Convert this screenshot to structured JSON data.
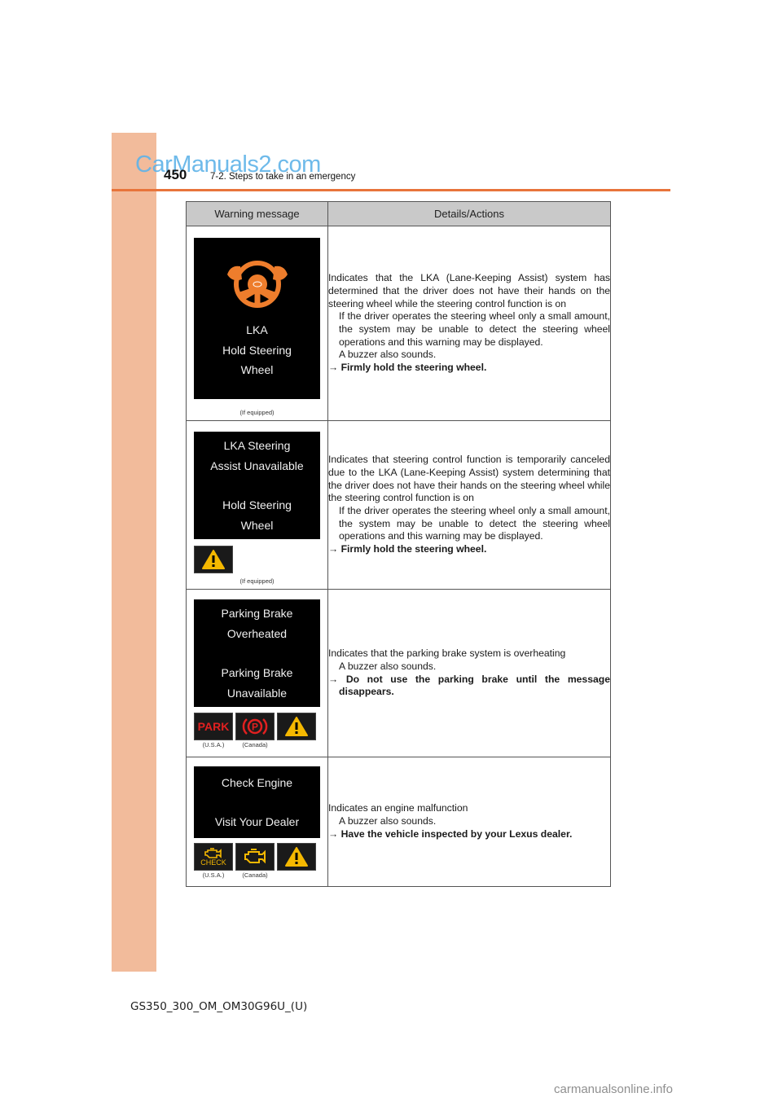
{
  "header": {
    "page_number": "450",
    "section_title": "7-2. Steps to take in an emergency",
    "watermark": "CarManuals2.com"
  },
  "table": {
    "columns": [
      "Warning message",
      "Details/Actions"
    ],
    "rows": [
      {
        "screen_lines": [
          "LKA",
          "Hold Steering",
          "Wheel"
        ],
        "screen_icon": "steering-wheel-hands-icon",
        "note": "(If equipped)",
        "indicators": [],
        "details": {
          "main": "Indicates that the LKA (Lane-Keeping Assist) system has determined that the driver does not have their hands on the steering wheel while the steering control function is on",
          "sub": [
            "If the driver operates the steering wheel only a small amount, the system may be unable to detect the steering wheel operations and this warning may be displayed.",
            "A buzzer also sounds."
          ],
          "action": "Firmly hold the steering wheel."
        }
      },
      {
        "screen_lines": [
          "LKA Steering",
          "Assist Unavailable",
          "",
          "Hold Steering",
          "Wheel"
        ],
        "note": "(If equipped)",
        "indicators": [
          {
            "icon": "master-warning-icon",
            "label": ""
          }
        ],
        "details": {
          "main": "Indicates that steering control function is temporarily canceled due to the LKA (Lane-Keeping Assist) system determining that the driver does not have their hands on the steering wheel while the steering control function is on",
          "sub": [
            "If the driver operates the steering wheel only a small amount, the system may be unable to detect the steering wheel operations and this warning may be displayed."
          ],
          "action": "Firmly hold the steering wheel."
        }
      },
      {
        "screen_lines": [
          "Parking Brake",
          "Overheated",
          "",
          "Parking Brake",
          "Unavailable"
        ],
        "note": "",
        "indicators": [
          {
            "icon": "park-text-icon",
            "text": "PARK",
            "label": "(U.S.A.)",
            "color": "#e02020"
          },
          {
            "icon": "parking-brake-p-icon",
            "text": "P",
            "label": "(Canada)",
            "color": "#e02020"
          },
          {
            "icon": "master-warning-icon",
            "label": ""
          }
        ],
        "details": {
          "main": "Indicates that the parking brake system is overheating",
          "sub": [
            "A buzzer also sounds."
          ],
          "action": "Do not use the parking brake until the message disappears."
        }
      },
      {
        "screen_lines": [
          "Check Engine",
          "",
          "Visit Your Dealer"
        ],
        "note": "",
        "indicators": [
          {
            "icon": "check-engine-text-icon",
            "text": "CHECK",
            "label": "(U.S.A.)",
            "color": "#f5b800"
          },
          {
            "icon": "check-engine-icon",
            "label": "(Canada)",
            "color": "#f5b800"
          },
          {
            "icon": "master-warning-icon",
            "label": ""
          }
        ],
        "details": {
          "main": "Indicates an engine malfunction",
          "sub": [
            "A buzzer also sounds."
          ],
          "action": "Have the vehicle inspected by your Lexus dealer."
        }
      }
    ]
  },
  "colors": {
    "sidebar": "#f2bb9b",
    "rule": "#e8743b",
    "warning_yellow": "#f5b800",
    "warning_red": "#e02020",
    "steering_orange": "#ee7d2c"
  },
  "footer": {
    "doc_code": "GS350_300_OM_OM30G96U_(U)",
    "watermark": "carmanualsonline.info"
  }
}
